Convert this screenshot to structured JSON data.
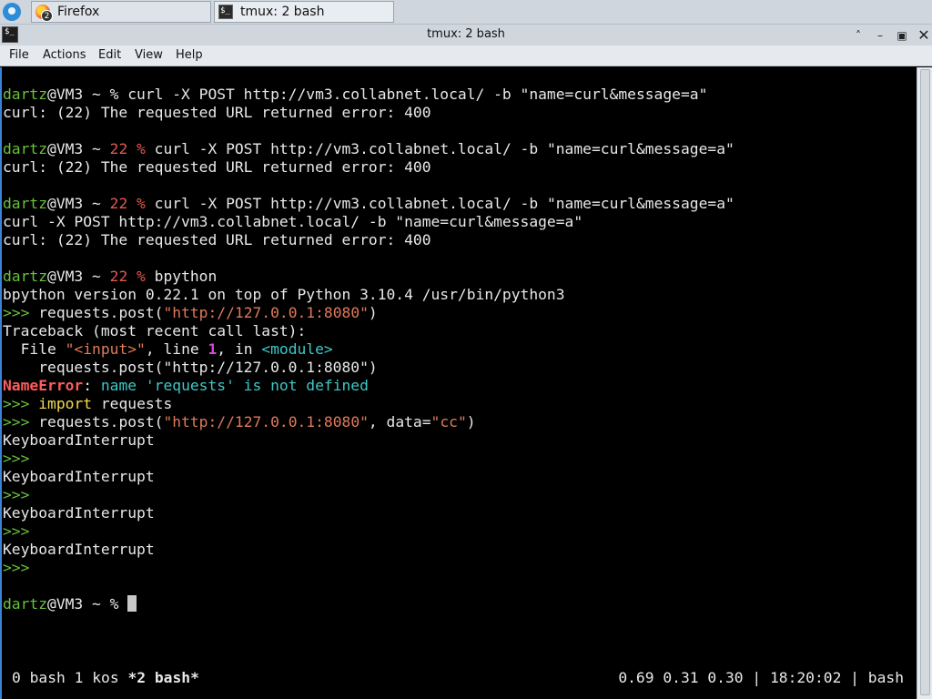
{
  "taskbar": {
    "tasks": [
      {
        "label": "Firefox",
        "badge": "2",
        "icon": "firefox-icon"
      },
      {
        "label": "tmux: 2 bash",
        "icon": "terminal-icon"
      }
    ]
  },
  "window": {
    "title": "tmux: 2 bash",
    "controls": [
      "shade",
      "minimize",
      "maximize",
      "close"
    ]
  },
  "menubar": {
    "items": [
      "File",
      "Actions",
      "Edit",
      "View",
      "Help"
    ]
  },
  "terminal": {
    "colors": {
      "user": "#67c23a",
      "exit_code": "#e05a4f",
      "error": "#ff5c5c",
      "string": "#e07a5a",
      "keyword": "#f3dd4f",
      "cyan": "#3fc8c8"
    },
    "lines": [
      [
        {
          "t": "dartz",
          "c": "g"
        },
        {
          "t": "@VM3 ~ % curl -X POST http://vm3.collabnet.local/ -b \"name=curl&message=a\""
        }
      ],
      [
        {
          "t": "curl: (22) The requested URL returned error: 400"
        }
      ],
      [],
      [
        {
          "t": "dartz",
          "c": "g"
        },
        {
          "t": "@VM3 ~ "
        },
        {
          "t": "22 %",
          "c": "r"
        },
        {
          "t": " curl -X POST http://vm3.collabnet.local/ -b \"name=curl&message=a\""
        }
      ],
      [
        {
          "t": "curl: (22) The requested URL returned error: 400"
        }
      ],
      [],
      [
        {
          "t": "dartz",
          "c": "g"
        },
        {
          "t": "@VM3 ~ "
        },
        {
          "t": "22 %",
          "c": "r"
        },
        {
          "t": " curl -X POST http://vm3.collabnet.local/ -b \"name=curl&message=a\""
        }
      ],
      [
        {
          "t": "curl -X POST http://vm3.collabnet.local/ -b \"name=curl&message=a\""
        }
      ],
      [
        {
          "t": "curl: (22) The requested URL returned error: 400"
        }
      ],
      [],
      [
        {
          "t": "dartz",
          "c": "g"
        },
        {
          "t": "@VM3 ~ "
        },
        {
          "t": "22 %",
          "c": "r"
        },
        {
          "t": " bpython"
        }
      ],
      [
        {
          "t": "bpython version 0.22.1 on top of Python 3.10.4 /usr/bin/python3"
        }
      ],
      [
        {
          "t": ">>>",
          "c": "g"
        },
        {
          "t": " requests.post("
        },
        {
          "t": "\"http://127.0.0.1:8080\"",
          "c": "o"
        },
        {
          "t": ")"
        }
      ],
      [
        {
          "t": "Traceback (most recent call last):"
        }
      ],
      [
        {
          "t": "  File "
        },
        {
          "t": "\"<input>\"",
          "c": "o"
        },
        {
          "t": ", line "
        },
        {
          "t": "1",
          "c": "m"
        },
        {
          "t": ", in "
        },
        {
          "t": "<module>",
          "c": "c"
        }
      ],
      [
        {
          "t": "    requests.post(\"http://127.0.0.1:8080\")"
        }
      ],
      [
        {
          "t": "NameError",
          "c": "err"
        },
        {
          "t": ": "
        },
        {
          "t": "name 'requests' is not defined",
          "c": "c"
        }
      ],
      [
        {
          "t": ">>>",
          "c": "g"
        },
        {
          "t": " "
        },
        {
          "t": "import",
          "c": "y"
        },
        {
          "t": " requests"
        }
      ],
      [
        {
          "t": ">>>",
          "c": "g"
        },
        {
          "t": " requests.post("
        },
        {
          "t": "\"http://127.0.0.1:8080\"",
          "c": "o"
        },
        {
          "t": ", data="
        },
        {
          "t": "\"cc\"",
          "c": "o"
        },
        {
          "t": ")"
        }
      ],
      [
        {
          "t": "KeyboardInterrupt"
        }
      ],
      [
        {
          "t": ">>>",
          "c": "g"
        }
      ],
      [
        {
          "t": "KeyboardInterrupt"
        }
      ],
      [
        {
          "t": ">>>",
          "c": "g"
        }
      ],
      [
        {
          "t": "KeyboardInterrupt"
        }
      ],
      [
        {
          "t": ">>>",
          "c": "g"
        }
      ],
      [
        {
          "t": "KeyboardInterrupt"
        }
      ],
      [
        {
          "t": ">>>",
          "c": "g"
        }
      ],
      [],
      [
        {
          "t": "dartz",
          "c": "g"
        },
        {
          "t": "@VM3 ~ % "
        },
        {
          "cursor": true
        }
      ]
    ]
  },
  "tmux_status": {
    "windows": [
      {
        "label": "0 bash",
        "active": false
      },
      {
        "label": "1 kos",
        "active": false
      },
      {
        "label": "*2 bash*",
        "active": true
      }
    ],
    "right": "0.69 0.31 0.30 | 18:20:02 | bash"
  }
}
